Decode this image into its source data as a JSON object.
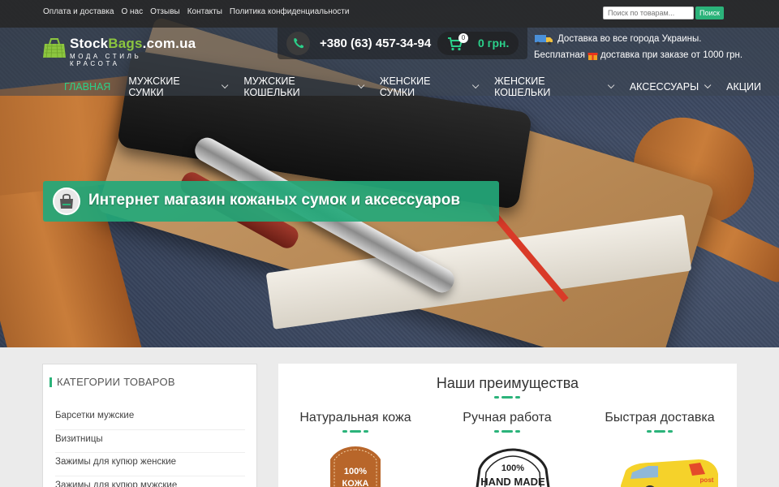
{
  "topbar": {
    "links": [
      "Оплата и доставка",
      "О нас",
      "Отзывы",
      "Контакты",
      "Политика конфиденциальности"
    ],
    "search_placeholder": "Поиск по товарам...",
    "search_button": "Поиск"
  },
  "logo": {
    "name_part1": "Stock",
    "name_part2": "Bags",
    "name_part3": ".com.ua",
    "tagline": "МОДА СТИЛЬ КРАСОТА"
  },
  "contact": {
    "phone": "+380 (63) 457-34-94",
    "cart_count": "0",
    "cart_sum": "0 грн."
  },
  "delivery": {
    "line1": "Доставка во все города Украины.",
    "line2a": "Бесплатная",
    "line2b": "доставка при заказе от 1000 грн."
  },
  "nav": {
    "items": [
      {
        "label": "ГЛАВНАЯ",
        "active": true,
        "dropdown": false
      },
      {
        "label": "МУЖСКИЕ СУМКИ",
        "active": false,
        "dropdown": true
      },
      {
        "label": "МУЖСКИЕ КОШЕЛЬКИ",
        "active": false,
        "dropdown": true
      },
      {
        "label": "ЖЕНСКИЕ СУМКИ",
        "active": false,
        "dropdown": true
      },
      {
        "label": "ЖЕНСКИЕ КОШЕЛЬКИ",
        "active": false,
        "dropdown": true
      },
      {
        "label": "АКСЕССУАРЫ",
        "active": false,
        "dropdown": true
      },
      {
        "label": "АКЦИИ",
        "active": false,
        "dropdown": false
      }
    ]
  },
  "banner": {
    "text": "Интернет магазин кожаных сумок и аксессуаров"
  },
  "categories": {
    "title": "КАТЕГОРИИ ТОВАРОВ",
    "items": [
      "Барсетки мужские",
      "Визитницы",
      "Зажимы для купюр женские",
      "Зажимы для купюр мужские"
    ]
  },
  "advantages": {
    "title": "Наши преимущества",
    "items": [
      {
        "title": "Натуральная кожа",
        "badge": "100%",
        "badge2": "КОЖА"
      },
      {
        "title": "Ручная работа",
        "badge": "100%",
        "badge2": "HAND MADE"
      },
      {
        "title": "Быстрая доставка",
        "badge": "post"
      }
    ]
  },
  "colors": {
    "accent": "#2bb37a",
    "accent_light": "#2bd08a",
    "logo_green": "#8cc63f"
  }
}
